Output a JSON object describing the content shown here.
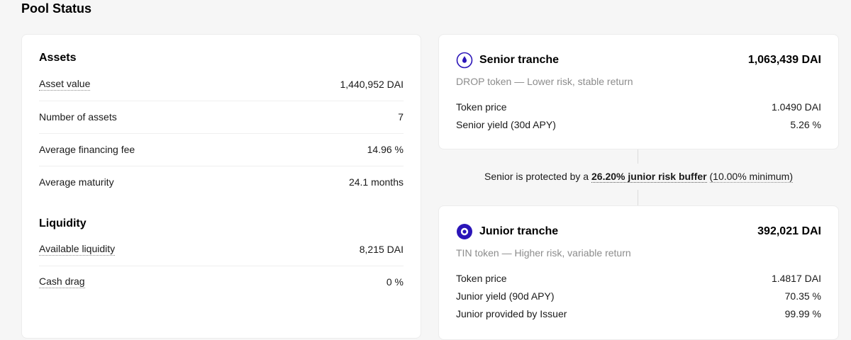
{
  "page": {
    "title": "Pool Status"
  },
  "assets": {
    "heading": "Assets",
    "rows": [
      {
        "label": "Asset value",
        "value": "1,440,952 DAI"
      },
      {
        "label": "Number of assets",
        "value": "7"
      },
      {
        "label": "Average financing fee",
        "value": "14.96 %"
      },
      {
        "label": "Average maturity",
        "value": "24.1 months"
      }
    ]
  },
  "liquidity": {
    "heading": "Liquidity",
    "rows": [
      {
        "label": "Available liquidity",
        "value": "8,215 DAI"
      },
      {
        "label": "Cash drag",
        "value": "0 %"
      }
    ]
  },
  "senior": {
    "name": "Senior tranche",
    "amount": "1,063,439 DAI",
    "description": "DROP token — Lower risk, stable return",
    "rows": [
      {
        "label": "Token price",
        "value": "1.0490 DAI"
      },
      {
        "label": "Senior yield (30d APY)",
        "value": "5.26 %"
      }
    ]
  },
  "buffer": {
    "prefix": "Senior is protected by a ",
    "highlight": "26.20% junior risk buffer",
    "minimum": "(10.00% minimum)"
  },
  "junior": {
    "name": "Junior tranche",
    "amount": "392,021 DAI",
    "description": "TIN token — Higher risk, variable return",
    "rows": [
      {
        "label": "Token price",
        "value": "1.4817 DAI"
      },
      {
        "label": "Junior yield (90d APY)",
        "value": "70.35 %"
      },
      {
        "label": "Junior provided by Issuer",
        "value": "99.99 %"
      }
    ]
  },
  "colors": {
    "accent": "#2b15b8",
    "text": "#000000",
    "muted": "#8c8c8c",
    "background": "#f6f6f6"
  },
  "icons": {
    "senior": "droplet-icon",
    "junior": "target-icon"
  }
}
